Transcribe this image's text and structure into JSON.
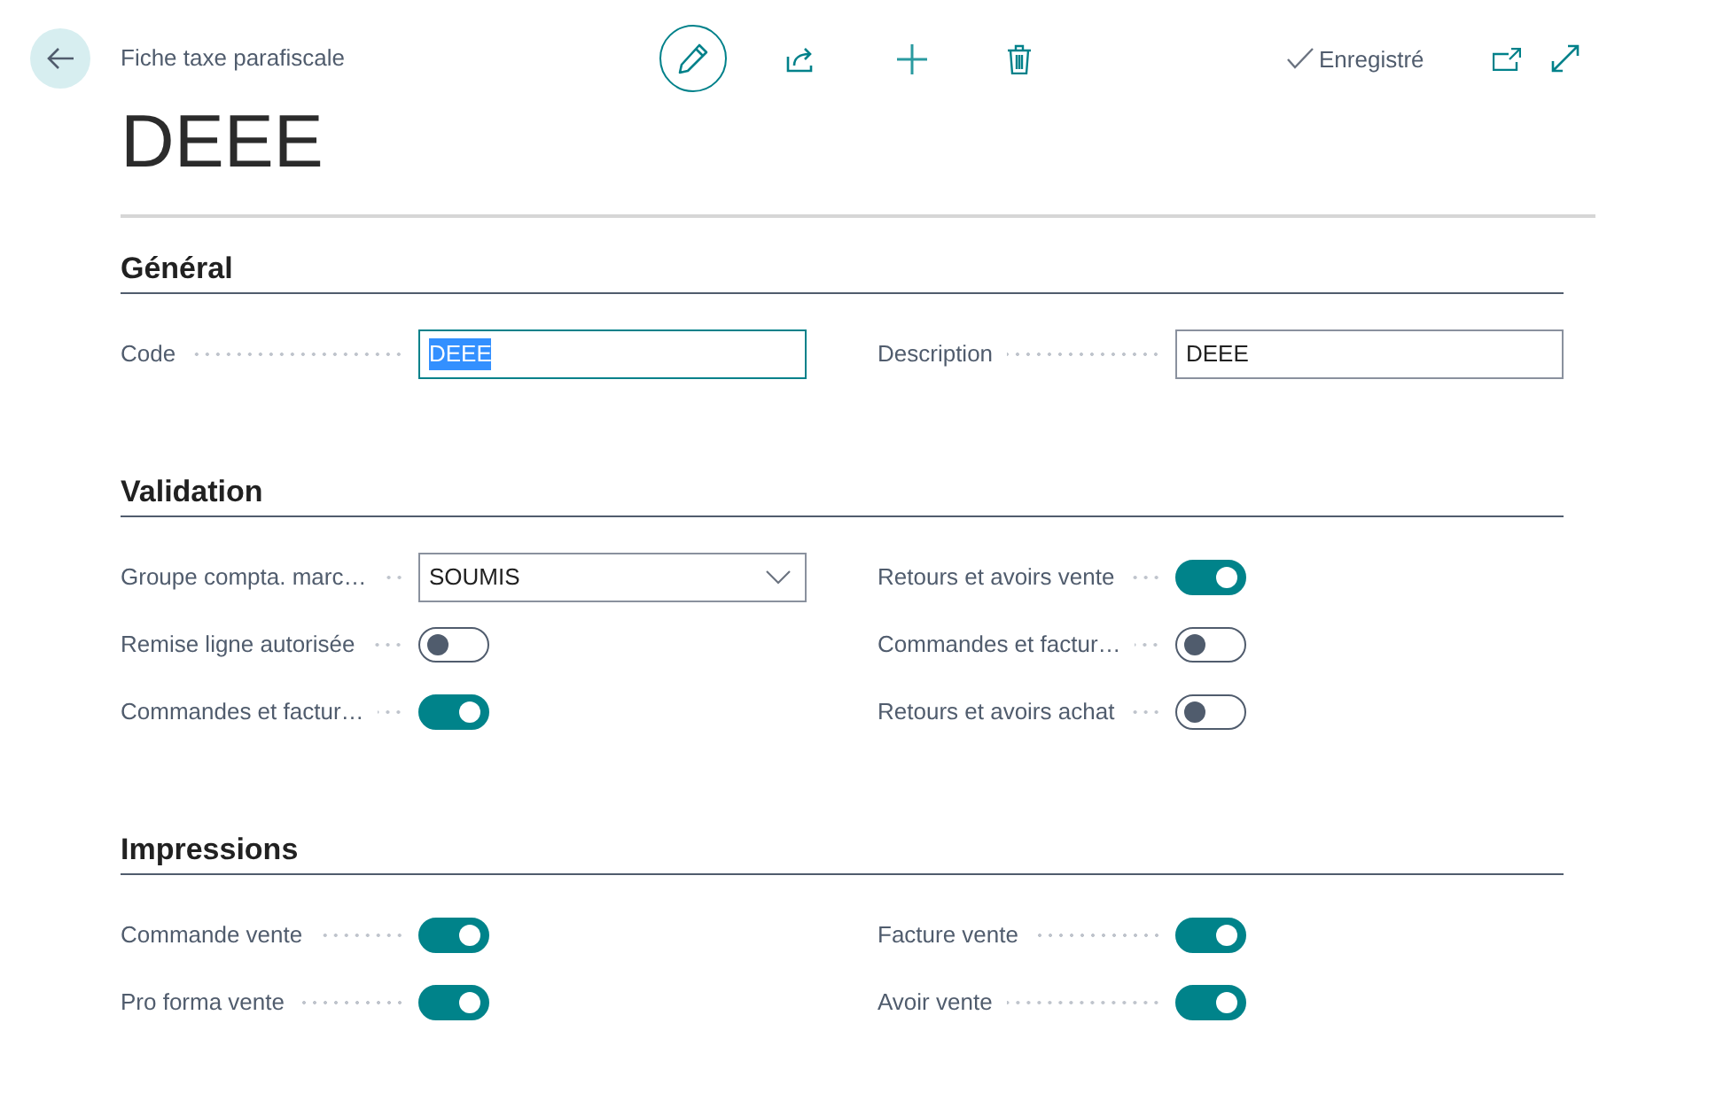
{
  "header": {
    "breadcrumb": "Fiche taxe parafiscale",
    "edit_mode": true,
    "status": "Enregistré",
    "page_title": "DEEE"
  },
  "sections": [
    {
      "title": "Général",
      "columns": [
        [
          {
            "kind": "text",
            "label": "Code",
            "value": "DEEE",
            "focused": true,
            "text_selected": true
          }
        ],
        [
          {
            "kind": "text",
            "label": "Description",
            "value": "DEEE",
            "focused": false,
            "text_selected": false
          }
        ]
      ]
    },
    {
      "title": "Validation",
      "columns": [
        [
          {
            "kind": "dropdown",
            "label": "Groupe compta. marc…",
            "value": "SOUMIS"
          },
          {
            "kind": "toggle",
            "label": "Remise ligne autorisée",
            "on": false
          },
          {
            "kind": "toggle",
            "label": "Commandes et factur…",
            "on": true
          }
        ],
        [
          {
            "kind": "toggle",
            "label": "Retours et avoirs vente",
            "on": true
          },
          {
            "kind": "toggle",
            "label": "Commandes et factur…",
            "on": false
          },
          {
            "kind": "toggle",
            "label": "Retours et avoirs achat",
            "on": false
          }
        ]
      ]
    },
    {
      "title": "Impressions",
      "columns": [
        [
          {
            "kind": "toggle",
            "label": "Commande vente",
            "on": true
          },
          {
            "kind": "toggle",
            "label": "Pro forma vente",
            "on": true
          }
        ],
        [
          {
            "kind": "toggle",
            "label": "Facture vente",
            "on": true
          },
          {
            "kind": "toggle",
            "label": "Avoir vente",
            "on": true
          }
        ]
      ]
    }
  ]
}
